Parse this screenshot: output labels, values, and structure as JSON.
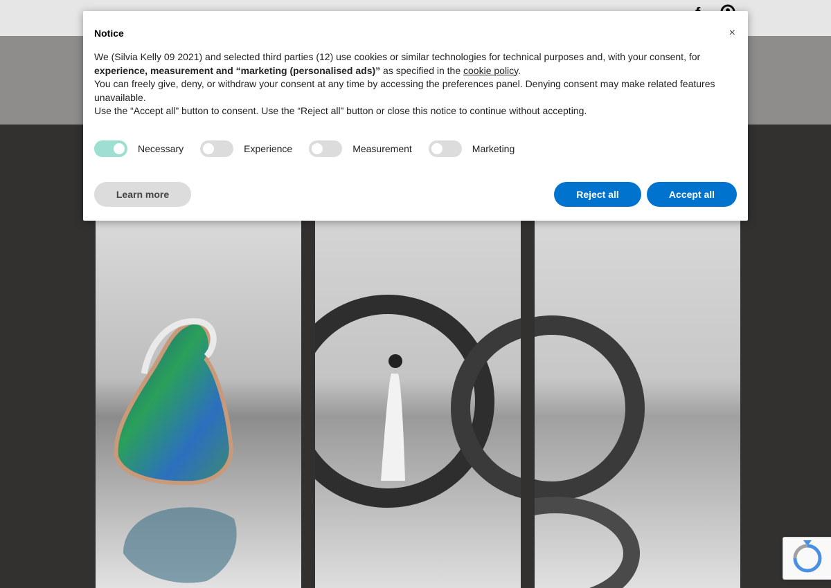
{
  "modal": {
    "title": "Notice",
    "close_label": "×",
    "text": {
      "p1_a": "We (Silvia Kelly 09 2021) and selected third parties (12) use cookies or similar technologies for technical purposes and, with your consent, for ",
      "p1_bold": "experience, measurement and “marketing (personalised ads)”",
      "p1_b": " as specified in the ",
      "p1_link": "cookie policy",
      "p1_c": ".",
      "p2": "You can freely give, deny, or withdraw your consent at any time by accessing the preferences panel. Denying consent may make related features unavailable.",
      "p3": "Use the “Accept all” button to consent. Use the “Reject all” button or close this notice to continue without accepting."
    },
    "toggles": [
      {
        "label": "Necessary",
        "on": true
      },
      {
        "label": "Experience",
        "on": false
      },
      {
        "label": "Measurement",
        "on": false
      },
      {
        "label": "Marketing",
        "on": false
      }
    ],
    "buttons": {
      "learn_more": "Learn more",
      "reject_all": "Reject all",
      "accept_all": "Accept all"
    }
  },
  "header": {
    "social_icons": [
      "facebook-icon",
      "pinterest-icon"
    ]
  },
  "colors": {
    "accent": "#0073ce",
    "toggle_on": "#9ddfd0",
    "toggle_off": "#dcdcdc",
    "page_bg": "#333130"
  }
}
